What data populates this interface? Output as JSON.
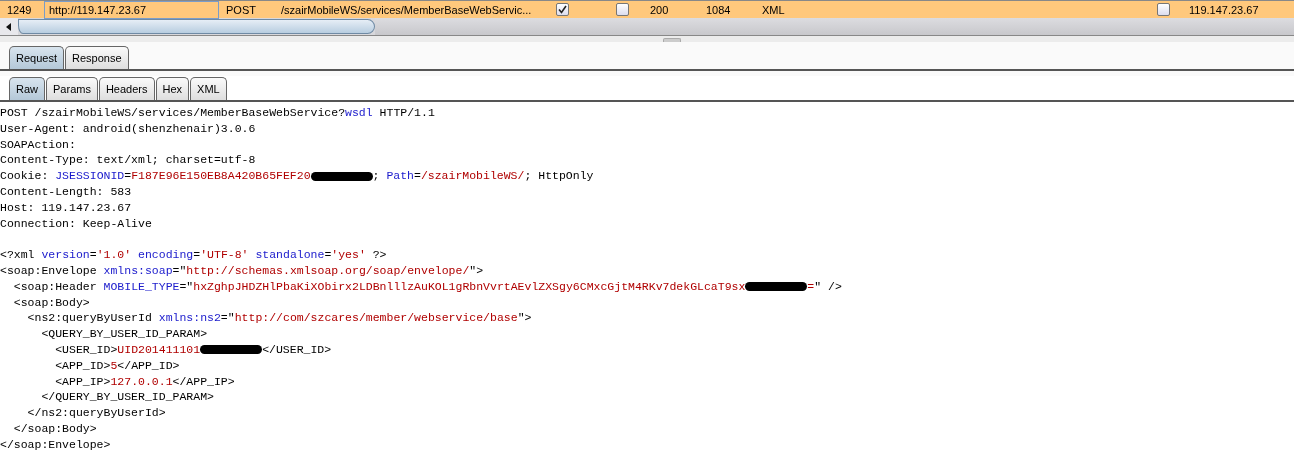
{
  "history_row": {
    "selected": true,
    "cells": [
      {
        "kind": "text",
        "text": "1249",
        "focused": false
      },
      {
        "kind": "text",
        "text": "http://119.147.23.67",
        "focused": true
      },
      {
        "kind": "text",
        "text": "POST",
        "focused": false
      },
      {
        "kind": "text",
        "text": "/szairMobileWS/services/MemberBaseWebServic...",
        "focused": false
      },
      {
        "kind": "checkbox",
        "checked": true
      },
      {
        "kind": "checkbox",
        "checked": false
      },
      {
        "kind": "text",
        "text": "200",
        "focused": false
      },
      {
        "kind": "text",
        "text": "1084",
        "focused": false
      },
      {
        "kind": "text",
        "text": "XML",
        "focused": false
      },
      {
        "kind": "checkbox",
        "checked": false
      },
      {
        "kind": "text",
        "text": "119.147.23.67",
        "focused": false
      }
    ]
  },
  "message_tabs": [
    {
      "label": "Request",
      "selected": true
    },
    {
      "label": "Response",
      "selected": false
    }
  ],
  "view_tabs": [
    {
      "label": "Raw",
      "selected": true
    },
    {
      "label": "Params",
      "selected": false
    },
    {
      "label": "Headers",
      "selected": false
    },
    {
      "label": "Hex",
      "selected": false
    },
    {
      "label": "XML",
      "selected": false
    }
  ],
  "raw_lines": [
    [
      {
        "kind": "plain",
        "text": "POST /szairMobileWS/services/MemberBaseWebService?"
      },
      {
        "kind": "key",
        "text": "wsdl"
      },
      {
        "kind": "plain",
        "text": " HTTP/1.1"
      }
    ],
    [
      {
        "kind": "plain",
        "text": "User-Agent: android(shenzhenair)3.0.6"
      }
    ],
    [
      {
        "kind": "plain",
        "text": "SOAPAction:"
      }
    ],
    [
      {
        "kind": "plain",
        "text": "Content-Type: text/xml; charset=utf-8"
      }
    ],
    [
      {
        "kind": "plain",
        "text": "Cookie: "
      },
      {
        "kind": "key",
        "text": "JSESSIONID"
      },
      {
        "kind": "plain",
        "text": "="
      },
      {
        "kind": "value",
        "text": "F187E96E150EB8A420B65FEF20"
      },
      {
        "kind": "redaction"
      },
      {
        "kind": "plain",
        "text": "; "
      },
      {
        "kind": "key",
        "text": "Path"
      },
      {
        "kind": "plain",
        "text": "="
      },
      {
        "kind": "value",
        "text": "/szairMobileWS/"
      },
      {
        "kind": "plain",
        "text": "; HttpOnly"
      }
    ],
    [
      {
        "kind": "plain",
        "text": "Content-Length: 583"
      }
    ],
    [
      {
        "kind": "plain",
        "text": "Host: 119.147.23.67"
      }
    ],
    [
      {
        "kind": "plain",
        "text": "Connection: Keep-Alive"
      }
    ],
    [
      {
        "kind": "blank"
      }
    ],
    [
      {
        "kind": "plain",
        "text": "<?xml "
      },
      {
        "kind": "key",
        "text": "version"
      },
      {
        "kind": "plain",
        "text": "="
      },
      {
        "kind": "value",
        "text": "'1.0'"
      },
      {
        "kind": "space"
      },
      {
        "kind": "key",
        "text": "encoding"
      },
      {
        "kind": "plain",
        "text": "="
      },
      {
        "kind": "value",
        "text": "'UTF-8'"
      },
      {
        "kind": "space"
      },
      {
        "kind": "key",
        "text": "standalone"
      },
      {
        "kind": "plain",
        "text": "="
      },
      {
        "kind": "value",
        "text": "'yes'"
      },
      {
        "kind": "plain",
        "text": " ?>"
      }
    ],
    [
      {
        "kind": "plain",
        "text": "<soap:Envelope "
      },
      {
        "kind": "key",
        "text": "xmlns:soap"
      },
      {
        "kind": "plain",
        "text": "=\""
      },
      {
        "kind": "value",
        "text": "http://schemas.xmlsoap.org/soap/envelope/"
      },
      {
        "kind": "plain",
        "text": "\">"
      }
    ],
    [
      {
        "kind": "plain",
        "text": "  <soap:Header "
      },
      {
        "kind": "key",
        "text": "MOBILE_TYPE"
      },
      {
        "kind": "plain",
        "text": "=\""
      },
      {
        "kind": "value",
        "text": "hxZghpJHDZHlPbaKiXObirx2LDBnlllzAuKOL1gRbnVvrtAEvlZXSgy6CMxcGjtM4RKv7dekGLcaT9sx"
      },
      {
        "kind": "redaction"
      },
      {
        "kind": "value",
        "text": "="
      },
      {
        "kind": "plain",
        "text": "\" />"
      }
    ],
    [
      {
        "kind": "plain",
        "text": "  <soap:Body>"
      }
    ],
    [
      {
        "kind": "plain",
        "text": "    <ns2:queryByUserId "
      },
      {
        "kind": "key",
        "text": "xmlns:ns2"
      },
      {
        "kind": "plain",
        "text": "=\""
      },
      {
        "kind": "value",
        "text": "http://com/szcares/member/webservice/base"
      },
      {
        "kind": "plain",
        "text": "\">"
      }
    ],
    [
      {
        "kind": "plain",
        "text": "      <QUERY_BY_USER_ID_PARAM>"
      }
    ],
    [
      {
        "kind": "plain",
        "text": "        <USER_ID>"
      },
      {
        "kind": "value",
        "text": "UID201411101"
      },
      {
        "kind": "redaction"
      },
      {
        "kind": "plain",
        "text": "</USER_ID>"
      }
    ],
    [
      {
        "kind": "plain",
        "text": "        <APP_ID>"
      },
      {
        "kind": "value",
        "text": "5"
      },
      {
        "kind": "plain",
        "text": "</APP_ID>"
      }
    ],
    [
      {
        "kind": "plain",
        "text": "        <APP_IP>"
      },
      {
        "kind": "value",
        "text": "127.0.0.1"
      },
      {
        "kind": "plain",
        "text": "</APP_IP>"
      }
    ],
    [
      {
        "kind": "plain",
        "text": "      </QUERY_BY_USER_ID_PARAM>"
      }
    ],
    [
      {
        "kind": "plain",
        "text": "    </ns2:queryByUserId>"
      }
    ],
    [
      {
        "kind": "plain",
        "text": "  </soap:Body>"
      }
    ],
    [
      {
        "kind": "plain",
        "text": "</soap:Envelope>"
      }
    ]
  ]
}
